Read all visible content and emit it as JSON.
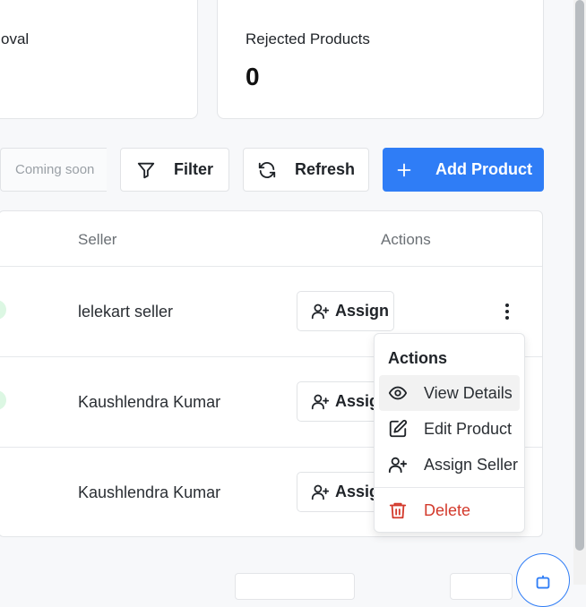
{
  "stats": {
    "pending_title_fragment": "oval",
    "rejected_title": "Rejected Products",
    "rejected_value": "0"
  },
  "toolbar": {
    "coming_soon": "Coming soon",
    "filter_label": "Filter",
    "refresh_label": "Refresh",
    "add_product_label": "Add Product"
  },
  "table": {
    "headers": {
      "seller": "Seller",
      "actions": "Actions"
    },
    "rows": [
      {
        "seller": "lelekart seller",
        "assign_label": "Assign"
      },
      {
        "seller": "Kaushlendra Kumar",
        "assign_label": "Assign"
      },
      {
        "seller": "Kaushlendra Kumar",
        "assign_label": "Assign"
      }
    ]
  },
  "actions_menu": {
    "title": "Actions",
    "items": [
      {
        "label": "View Details",
        "icon": "eye-icon"
      },
      {
        "label": "Edit Product",
        "icon": "edit-icon"
      },
      {
        "label": "Assign Seller",
        "icon": "user-plus-icon"
      },
      {
        "label": "Delete",
        "icon": "trash-icon"
      }
    ]
  },
  "colors": {
    "primary": "#2f7df6",
    "danger": "#d33a2c",
    "status_green": "#dcf7e3"
  }
}
